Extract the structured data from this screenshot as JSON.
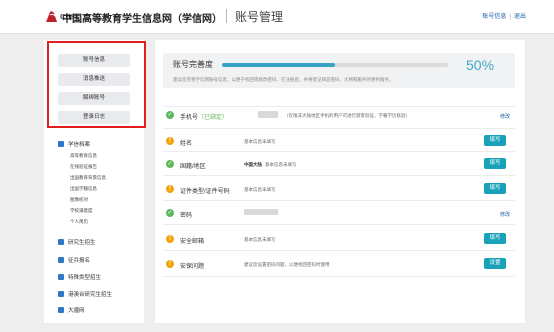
{
  "header": {
    "logo_text": "CHSI",
    "site_name": "中国高等教育学生信息网（学信网）",
    "page_title": "账号管理",
    "links": [
      "账号信息",
      "退出"
    ]
  },
  "sidebar": {
    "menu": [
      "账号信息",
      "消息推送",
      "解绑账号",
      "登录日志"
    ],
    "sections": [
      {
        "label": "学信档案",
        "items": [
          "高等教育信息",
          "在线验证报告",
          "出国教育背景信息",
          "出国学籍信息",
          "图像校对",
          "学校满意度",
          "个人简历"
        ]
      },
      {
        "label": "研究生招生",
        "items": []
      },
      {
        "label": "征兵报名",
        "items": []
      },
      {
        "label": "特殊类型招生",
        "items": []
      },
      {
        "label": "港澳台研究生招生",
        "items": []
      },
      {
        "label": "大疆网",
        "items": []
      }
    ]
  },
  "completeness": {
    "label": "账号完善度",
    "percent_text": "50%",
    "value": 0.5,
    "hint": "建议您完善学信网账号信息，以便于找回或修改密码、在注册后，并将登记目前密码、大将网服务的便利服务。"
  },
  "fields": [
    {
      "label": "手机号",
      "bound": "（已绑定）",
      "value": "（仅限非大陆地区手机的用户可进行游客验证，学籍学历核验）",
      "action": "修改",
      "status": "ok"
    },
    {
      "label": "姓名",
      "value": "基本信息未填写",
      "action": "填写",
      "status": "warn"
    },
    {
      "label": "国籍/地区",
      "value_bold": "中国大陆",
      "value": "基本信息未填写",
      "action": "填写",
      "status": "ok"
    },
    {
      "label": "证件类型/证件号码",
      "value": "基本信息未填写",
      "action": "填写",
      "status": "warn"
    },
    {
      "label": "密码",
      "value": "",
      "action": "修改",
      "status": "ok"
    },
    {
      "label": "安全邮箱",
      "value": "基本信息未填写",
      "action": "填写",
      "status": "warn"
    },
    {
      "label": "安保问题",
      "value": "建议您设置密码问题，以便找回密码时使用",
      "action": "设置",
      "status": "warn"
    }
  ],
  "colors": {
    "accent": "#17a2b8",
    "ok": "#5cb85c",
    "warn": "#f0a30a",
    "highlight_box": "#e02020"
  },
  "icons": {
    "status_ok": "check-circle-icon",
    "status_warn": "exclamation-circle-icon"
  }
}
